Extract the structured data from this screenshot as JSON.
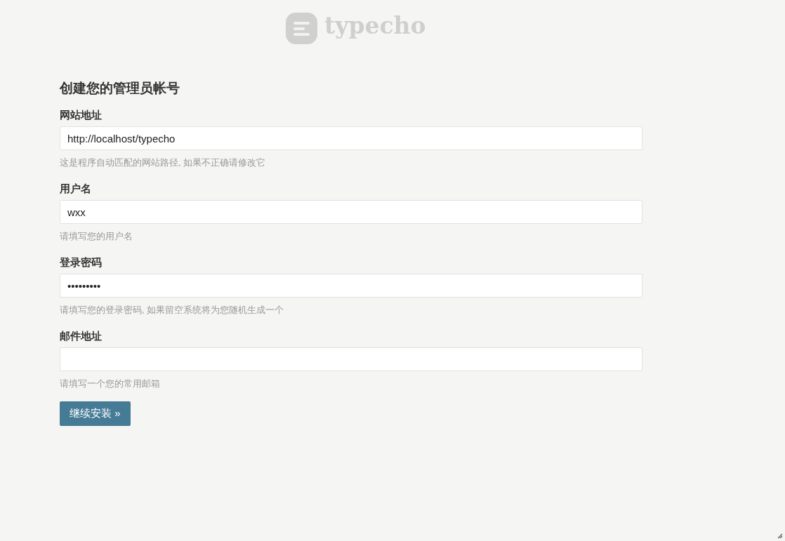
{
  "logo": {
    "text": "typecho"
  },
  "form": {
    "title": "创建您的管理员帐号",
    "fields": [
      {
        "label": "网站地址",
        "value": "http://localhost/typecho",
        "hint": "这是程序自动匹配的网站路径, 如果不正确请修改它"
      },
      {
        "label": "用户名",
        "value": "wxx",
        "hint": "请填写您的用户名"
      },
      {
        "label": "登录密码",
        "value": "•••••••••",
        "hint": "请填写您的登录密码, 如果留空系统将为您随机生成一个"
      },
      {
        "label": "邮件地址",
        "hint": "请填写一个您的常用邮箱"
      }
    ],
    "submit": "继续安装 »"
  }
}
